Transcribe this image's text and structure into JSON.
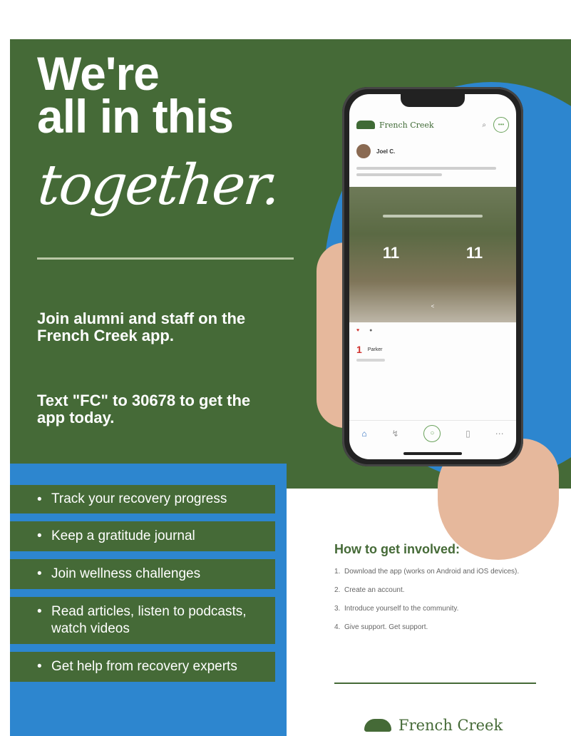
{
  "headline": {
    "line1": "We're",
    "line2": "all in this",
    "script": "together."
  },
  "intro": {
    "join": "Join alumni and staff on the French Creek app.",
    "text_cta": "Text \"FC\" to 30678 to get the app today."
  },
  "features": [
    "Track your recovery progress",
    "Keep a gratitude journal",
    "Join wellness challenges",
    "Read articles, listen to podcasts, watch videos",
    "Get help from recovery experts"
  ],
  "phone": {
    "app_name": "French Creek",
    "author": "Joel C.",
    "photo_numbers": [
      "11",
      "11"
    ],
    "comment_author": "Parker"
  },
  "how_to": {
    "title": "How to get involved:",
    "steps": [
      {
        "n": "1.",
        "text": "Download the app (works on Android and iOS devices)."
      },
      {
        "n": "2.",
        "text": "Create an account."
      },
      {
        "n": "3.",
        "text": "Introduce yourself to the community."
      },
      {
        "n": "4.",
        "text": "Give support. Get support."
      }
    ]
  },
  "footer": {
    "brand": "French Creek"
  },
  "colors": {
    "green": "#456a37",
    "blue": "#2d86cf"
  }
}
